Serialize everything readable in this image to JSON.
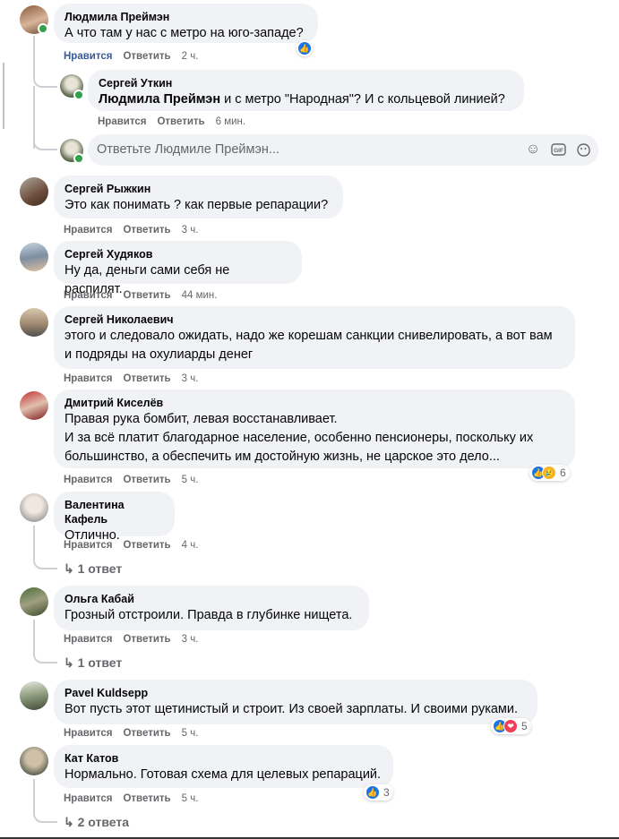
{
  "actions": {
    "like": "Нравится",
    "reply": "Ответить"
  },
  "comments": [
    {
      "name": "Людмила Преймэн",
      "text": "А что там у нас с метро на юго-западе?",
      "time": "2 ч.",
      "reaction_icon": "like-icon"
    },
    {
      "name": "Сергей Рыжкин",
      "text": "Это как понимать ? как первые репарации?",
      "time": "3 ч."
    },
    {
      "name": "Сергей Худяков",
      "text": "Ну да, деньги сами себя не распилят.",
      "time": "44 мин."
    },
    {
      "name": "Сергей Николаевич",
      "text": "этого и следовало ожидать, надо же корешам санкции снивелировать, а вот вам",
      "text2": "и подряды на охулиарды денег",
      "time": "3 ч."
    },
    {
      "name": "Дмитрий Киселёв",
      "text": "Правая рука бомбит, левая восстанавливает.",
      "text2": "И за всё платит благодарное население, особенно пенсионеры, поскольку их",
      "text3": "большинство, а обеспечить им достойную жизнь, не царское это дело...",
      "time": "5 ч.",
      "reaction_count": "6"
    },
    {
      "name": "Валентина Кафель",
      "text": "Отлично.",
      "time": "4 ч.",
      "replies": "1 ответ"
    },
    {
      "name": "Ольга Кабай",
      "text": "Грозный отстроили. Правда в глубинке нищета.",
      "time": "3 ч.",
      "replies": "1 ответ"
    },
    {
      "name": "Pavel Kuldsepp",
      "text": "Вот пусть этот щетинистый и строит. Из своей зарплаты. И своими руками.",
      "time": "5 ч.",
      "reaction_count": "5"
    },
    {
      "name": "Кат Катов",
      "text": "Нормально. Готовая схема для целевых репараций.",
      "time": "5 ч.",
      "reaction_count": "3",
      "replies": "2 ответа"
    }
  ],
  "reply": {
    "name": "Сергей Уткин",
    "mention": "Людмила Преймэн",
    "text": " и с метро \"Народная\"? И с кольцевой линией?",
    "time": "6 мин."
  },
  "reply_input": {
    "placeholder": "Ответьте Людмиле Преймэн..."
  },
  "icons": [
    "emoji-icon",
    "gif-icon",
    "sticker-icon"
  ],
  "colors": {
    "like_blue": "#1b74e4",
    "liked_text": "#385898",
    "bubble_bg": "#f0f2f5",
    "online": "#31a24c"
  }
}
